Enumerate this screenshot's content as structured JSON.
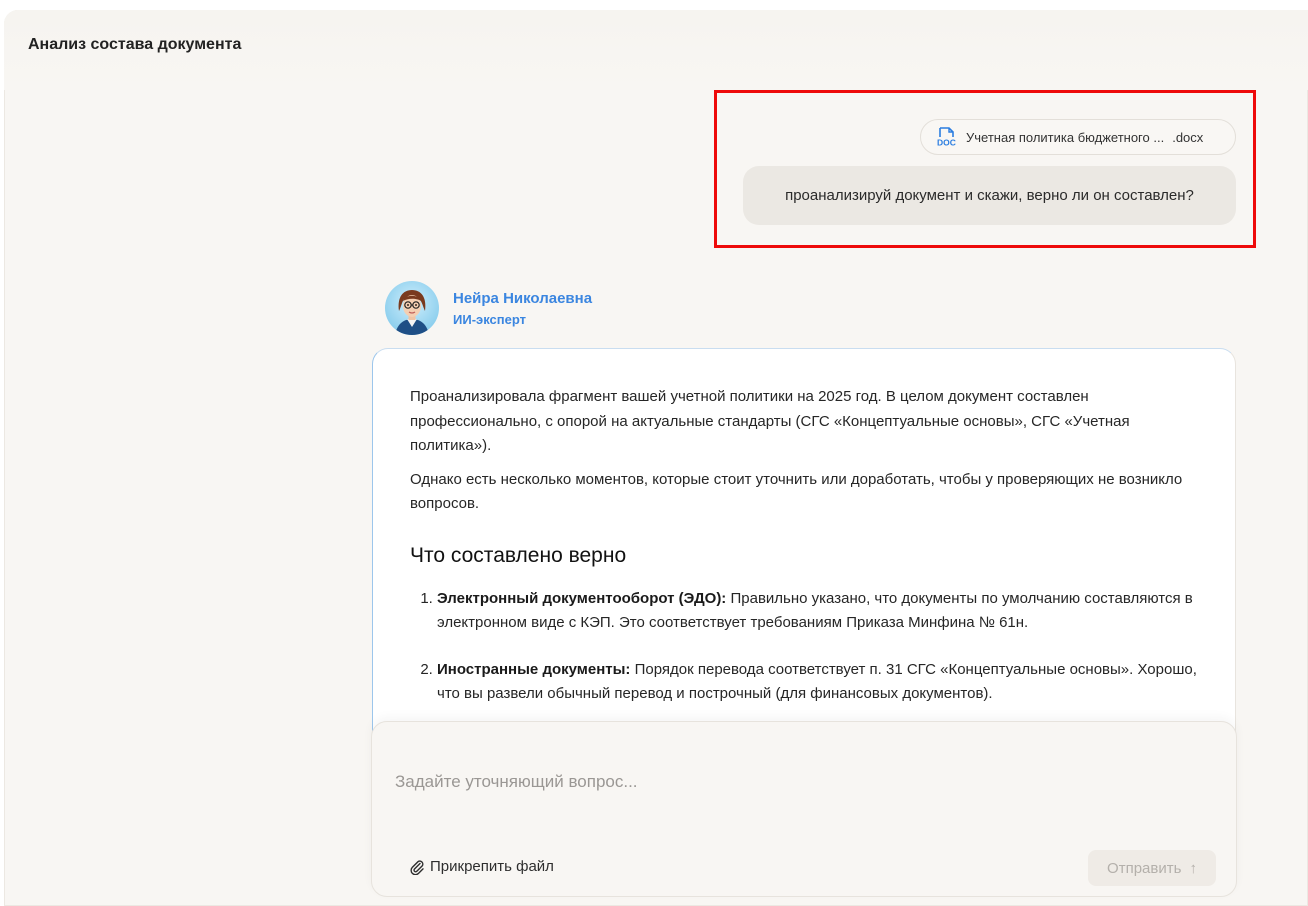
{
  "header": {
    "title": "Анализ состава документа"
  },
  "user_message": {
    "attachment": {
      "icon": "docx-file-icon",
      "icon_label": "DOC",
      "name": "Учетная политика бюджетного ...",
      "extension": ".docx"
    },
    "text": "проанализируй документ и скажи, верно ли он составлен?"
  },
  "assistant": {
    "name": "Нейра Николаевна",
    "role": "ИИ-эксперт",
    "name_color": "#3b86e0"
  },
  "answer": {
    "paragraphs": [
      "Проанализировала фрагмент вашей учетной политики на 2025 год. В целом документ составлен профессионально, с опорой на актуальные стандарты (СГС «Концептуальные основы», СГС «Учетная политика»).",
      "Однако есть несколько моментов, которые стоит уточнить или доработать, чтобы у проверяющих не возникло вопросов."
    ],
    "heading": "Что составлено верно",
    "items": [
      {
        "title": "Электронный документооборот (ЭДО):",
        "text": " Правильно указано, что документы по умолчанию составляются в электронном виде с КЭП. Это соответствует требованиям Приказа Минфина № 61н."
      },
      {
        "title": "Иностранные документы:",
        "text": " Порядок перевода соответствует п. 31 СГС «Концептуальные основы». Хорошо, что вы развели обычный перевод и построчный (для финансовых документов)."
      }
    ]
  },
  "composer": {
    "placeholder": "Задайте уточняющий вопрос...",
    "attach_label": "Прикрепить файл",
    "send_label": "Отправить",
    "send_icon": "↑"
  },
  "colors": {
    "background": "#f8f6f3",
    "highlight_frame": "#ee0a0a",
    "accent": "#3b86e0"
  }
}
